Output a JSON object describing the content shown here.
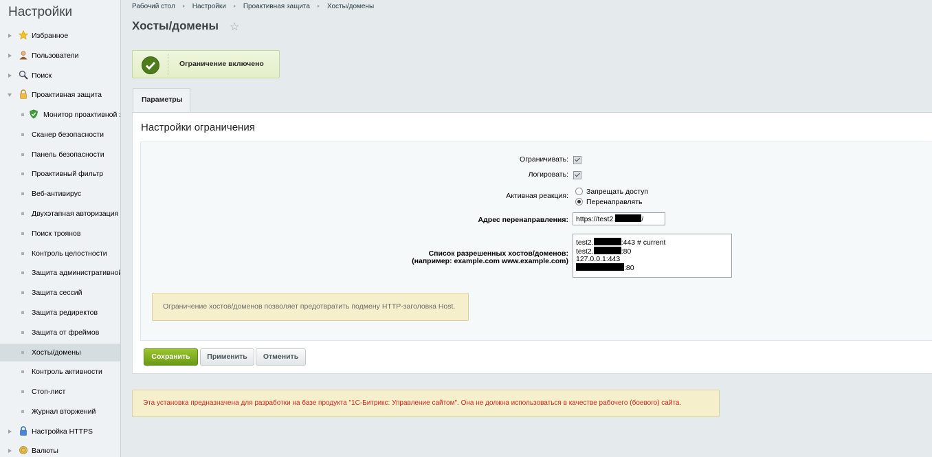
{
  "sidebar": {
    "title": "Настройки",
    "items": [
      {
        "label": "Избранное",
        "icon": "star-icon"
      },
      {
        "label": "Пользователи",
        "icon": "user-icon"
      },
      {
        "label": "Поиск",
        "icon": "magnifier-icon"
      },
      {
        "label": "Проактивная защита",
        "icon": "lock-icon"
      },
      {
        "label": "Монитор проактивной защиты",
        "icon": "shield-check-icon"
      },
      {
        "label": "Сканер безопасности"
      },
      {
        "label": "Панель безопасности"
      },
      {
        "label": "Проактивный фильтр"
      },
      {
        "label": "Веб-антивирус"
      },
      {
        "label": "Двухэтапная авторизация"
      },
      {
        "label": "Поиск троянов"
      },
      {
        "label": "Контроль целостности"
      },
      {
        "label": "Защита административной части"
      },
      {
        "label": "Защита сессий"
      },
      {
        "label": "Защита редиректов"
      },
      {
        "label": "Защита от фреймов"
      },
      {
        "label": "Хосты/домены"
      },
      {
        "label": "Контроль активности"
      },
      {
        "label": "Стоп-лист"
      },
      {
        "label": "Журнал вторжений"
      },
      {
        "label": "Настройка HTTPS",
        "icon": "lock-https-icon"
      },
      {
        "label": "Валюты",
        "icon": "coins-icon"
      }
    ]
  },
  "breadcrumbs": [
    "Рабочий стол",
    "Настройки",
    "Проактивная защита",
    "Хосты/домены"
  ],
  "page": {
    "title": "Хосты/домены"
  },
  "status": {
    "text": "Ограничение включено"
  },
  "tabs": [
    {
      "label": "Параметры"
    }
  ],
  "section": {
    "title": "Настройки ограничения"
  },
  "form": {
    "restrict_label": "Ограничивать:",
    "restrict_checked": true,
    "log_label": "Логировать:",
    "log_checked": true,
    "reaction_label": "Активная реакция:",
    "reaction_options": [
      "Запрещать доступ",
      "Перенаправлять"
    ],
    "reaction_selected": "Перенаправлять",
    "redirect_label": "Адрес перенаправления:",
    "redirect_value_prefix": "https://test2.",
    "redirect_value_suffix": "/",
    "hosts_label_line1": "Список разрешенных хостов/доменов:",
    "hosts_label_line2": "(например: example.com www.example.com)",
    "hosts_lines": [
      {
        "prefix": "test2.",
        "suffix": ":443 # current"
      },
      {
        "prefix": "test2.",
        "suffix": ":80"
      },
      {
        "prefix": "127.0.0.1:443",
        "suffix": ""
      },
      {
        "prefix": "",
        "suffix": ":80"
      }
    ],
    "note": "Ограничение хостов/доменов позволяет предотвратить подмену HTTP-заголовка Host."
  },
  "buttons": {
    "save": "Сохранить",
    "apply": "Применить",
    "cancel": "Отменить"
  },
  "warning": "Эта установка предназначена для разработки на базе продукта \"1С-Битрикс: Управление сайтом\". Она не должна использоваться в качестве рабочего (боевого) сайта.",
  "colors": {
    "accent_green": "#6b9a16",
    "warning_red": "#d32222",
    "note_bg": "#f6efcb"
  }
}
